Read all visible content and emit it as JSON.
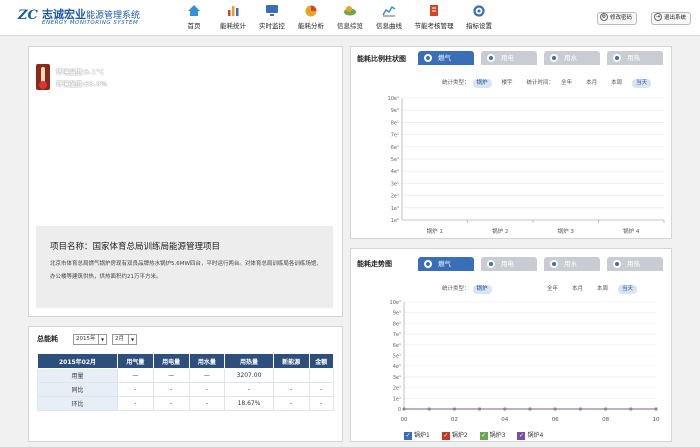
{
  "header": {
    "logo_mark": "ZC",
    "title": "志诚宏业",
    "subtitle": "能源管理系统",
    "title_en": "ENERGY MONITORING SYSTEM",
    "nav": [
      {
        "label": "首页",
        "icon": "home-icon",
        "color": "#3a8fd6"
      },
      {
        "label": "能耗统计",
        "icon": "bar-chart-icon",
        "color": "#d0452c"
      },
      {
        "label": "实时监控",
        "icon": "monitor-icon",
        "color": "#3a6fb8"
      },
      {
        "label": "能耗分析",
        "icon": "pie-chart-icon",
        "color": "#e7a321"
      },
      {
        "label": "信息综览",
        "icon": "cloud-icon",
        "color": "#6aa84f"
      },
      {
        "label": "信息曲线",
        "icon": "line-chart-icon",
        "color": "#3a8fd6"
      },
      {
        "label": "节能考核管理",
        "icon": "document-icon",
        "color": "#d0452c"
      },
      {
        "label": "指标设置",
        "icon": "settings-icon",
        "color": "#3a6fb8"
      }
    ],
    "change_password": "修改密码",
    "logout": "退出系统"
  },
  "environment": {
    "temperature": "环境温度:5.1℃",
    "humidity": "环境湿度:63.0%"
  },
  "project": {
    "name": "项目名称：国家体育总局训练局能源管理项目",
    "description": "北京市体育总局燃气锅炉房现有双良品牌热水锅炉5.6MW四台，平时运行两台。对体育总局训练局各训练场馆、办公楼等建筑供热，供热面积约21万平方米。"
  },
  "total_energy": {
    "label": "总能耗",
    "year": "2015年",
    "month": "2月",
    "headers": [
      "2015年02月",
      "用气量",
      "用电量",
      "用水量",
      "用热量",
      "新能源",
      "金额"
    ],
    "rows": [
      [
        "用量",
        "—",
        "—",
        "—",
        "3207.00",
        "",
        ""
      ],
      [
        "同比",
        "-",
        "-",
        "-",
        "-",
        "-",
        "-"
      ],
      [
        "环比",
        "-",
        "-",
        "-",
        "18.67%",
        "-",
        "-"
      ]
    ]
  },
  "bar_chart": {
    "title": "能耗比例柱状图",
    "tabs": [
      "燃气",
      "用电",
      "用水",
      "用热"
    ],
    "stat_type_label": "统计类型：",
    "stat_types": [
      "锅炉",
      "楼宇"
    ],
    "stat_time_label": "统计时间：",
    "stat_times": [
      "全年",
      "本月",
      "本周",
      "当天"
    ]
  },
  "line_chart": {
    "title": "能耗走势图",
    "tabs": [
      "燃气",
      "用电",
      "用水",
      "用热"
    ],
    "stat_type_label": "统计类型：",
    "stat_types": [
      "锅炉"
    ],
    "stat_times": [
      "全年",
      "本月",
      "本周",
      "当天"
    ],
    "legend": [
      "锅炉1",
      "锅炉2",
      "锅炉3",
      "锅炉4"
    ],
    "legend_colors": [
      "#3a6fb8",
      "#c0392b",
      "#6aa84f",
      "#7b4fa0"
    ]
  },
  "chart_data": [
    {
      "type": "bar",
      "categories": [
        "锅炉 1",
        "锅炉 2",
        "锅炉 3",
        "锅炉 4"
      ],
      "values": [
        0,
        0,
        0,
        0
      ],
      "y_ticks": [
        "1e⁰",
        "1e¹",
        "2e¹",
        "3e¹",
        "4e¹",
        "5e¹",
        "6e¹",
        "7e¹",
        "8e¹",
        "9e¹",
        "10e¹"
      ],
      "grid": true
    },
    {
      "type": "line",
      "x": [
        "00",
        "02",
        "04",
        "06",
        "08",
        "10"
      ],
      "y_ticks": [
        "0",
        "1e¹",
        "2e¹",
        "3e¹",
        "4e¹",
        "5e¹",
        "6e¹",
        "7e¹",
        "8e¹",
        "9e¹",
        "10e¹"
      ],
      "series": [
        {
          "name": "锅炉1",
          "values": [
            0,
            0,
            0,
            0,
            0,
            0,
            0,
            0,
            0,
            0,
            0
          ]
        },
        {
          "name": "锅炉2",
          "values": [
            0,
            0,
            0,
            0,
            0,
            0,
            0,
            0,
            0,
            0,
            0
          ]
        },
        {
          "name": "锅炉3",
          "values": [
            0,
            0,
            0,
            0,
            0,
            0,
            0,
            0,
            0,
            0,
            0
          ]
        },
        {
          "name": "锅炉4",
          "values": [
            0,
            0,
            0,
            0,
            0,
            0,
            0,
            0,
            0,
            0,
            0
          ]
        }
      ]
    }
  ]
}
